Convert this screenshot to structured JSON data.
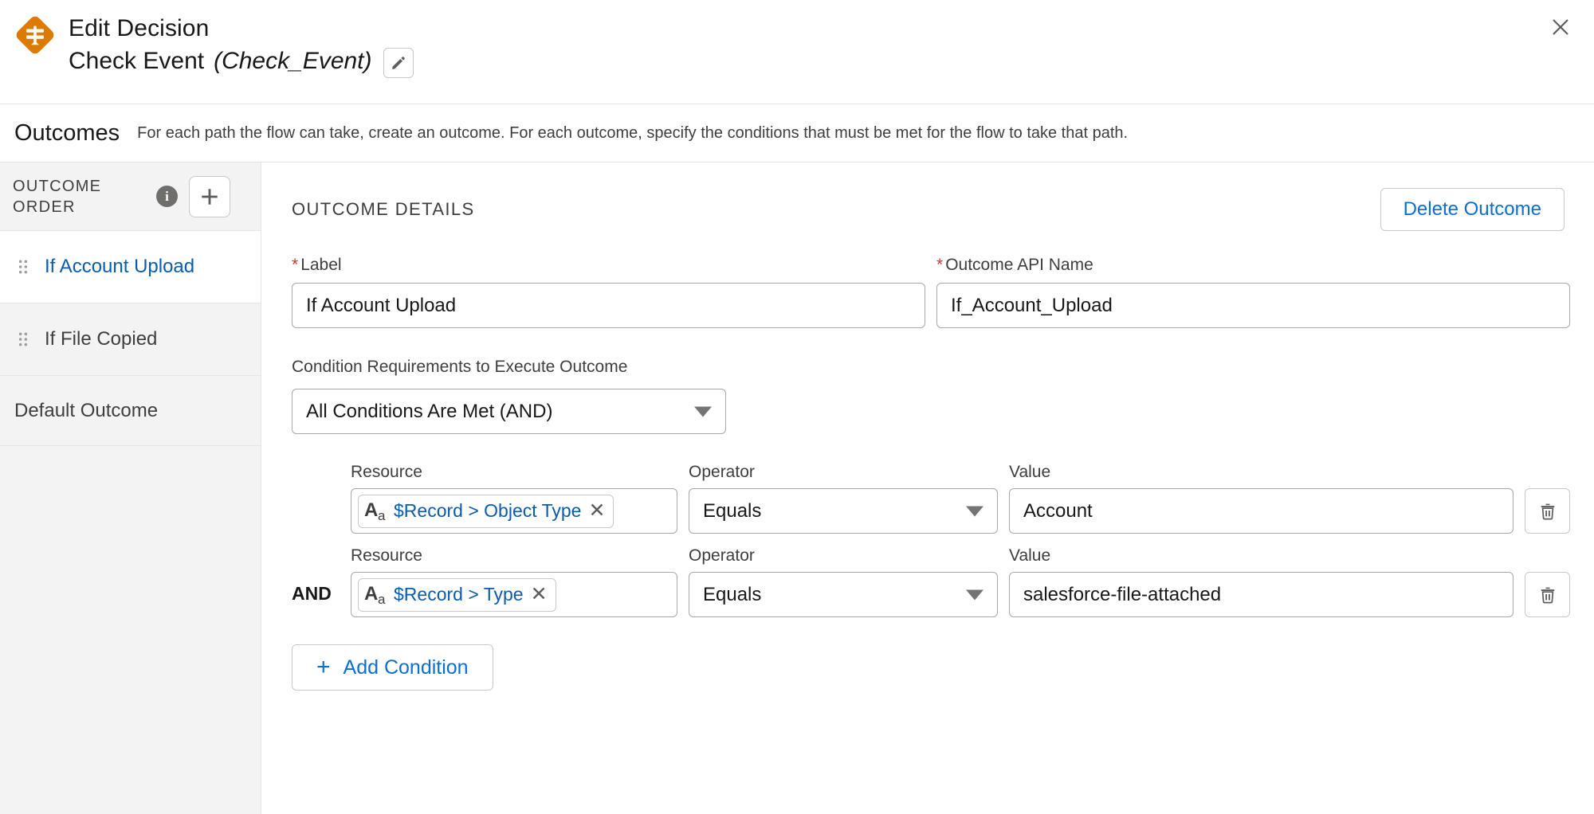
{
  "header": {
    "icon_name": "decision-diamond-icon",
    "line1": "Edit Decision",
    "element_label": "Check Event",
    "element_api_name": "(Check_Event)",
    "edit_icon": "pencil-icon",
    "close_icon": "close-icon",
    "icon_color": "#DD7A01"
  },
  "section": {
    "title": "Outcomes",
    "description": "For each path the flow can take, create an outcome. For each outcome, specify the conditions that must be met for the flow to take that path."
  },
  "sidebar": {
    "title": "OUTCOME ORDER",
    "info_icon": "info-icon",
    "add_icon": "plus-icon",
    "items": [
      {
        "label": "If Account Upload",
        "selected": true
      },
      {
        "label": "If File Copied",
        "selected": false
      }
    ],
    "default_outcome": "Default Outcome"
  },
  "details": {
    "title": "OUTCOME DETAILS",
    "delete_button": "Delete Outcome",
    "label_field": {
      "label": "Label",
      "required_mark": "*",
      "value": "If Account Upload"
    },
    "api_name_field": {
      "label": "Outcome API Name",
      "required_mark": "*",
      "value": "If_Account_Upload"
    },
    "condition_requirements": {
      "label": "Condition Requirements to Execute Outcome",
      "selected": "All Conditions Are Met (AND)"
    },
    "column_headers": {
      "resource": "Resource",
      "operator": "Operator",
      "value": "Value"
    },
    "conditions": [
      {
        "logic_prefix": "",
        "resource": "$Record > Object Type",
        "resource_type_icon": "text-type-icon",
        "resource_remove_icon": "remove-pill-icon",
        "operator": "Equals",
        "value": "Account",
        "delete_icon": "trash-icon"
      },
      {
        "logic_prefix": "AND",
        "resource": "$Record > Type",
        "resource_type_icon": "text-type-icon",
        "resource_remove_icon": "remove-pill-icon",
        "operator": "Equals",
        "value": "salesforce-file-attached",
        "delete_icon": "trash-icon"
      }
    ],
    "add_condition_button": "Add Condition",
    "add_condition_icon": "plus-icon"
  },
  "colors": {
    "accent_link": "#0b6fd1",
    "selected_text": "#0b5cab",
    "required": "#c23934",
    "decision_orange": "#DD7A01"
  }
}
